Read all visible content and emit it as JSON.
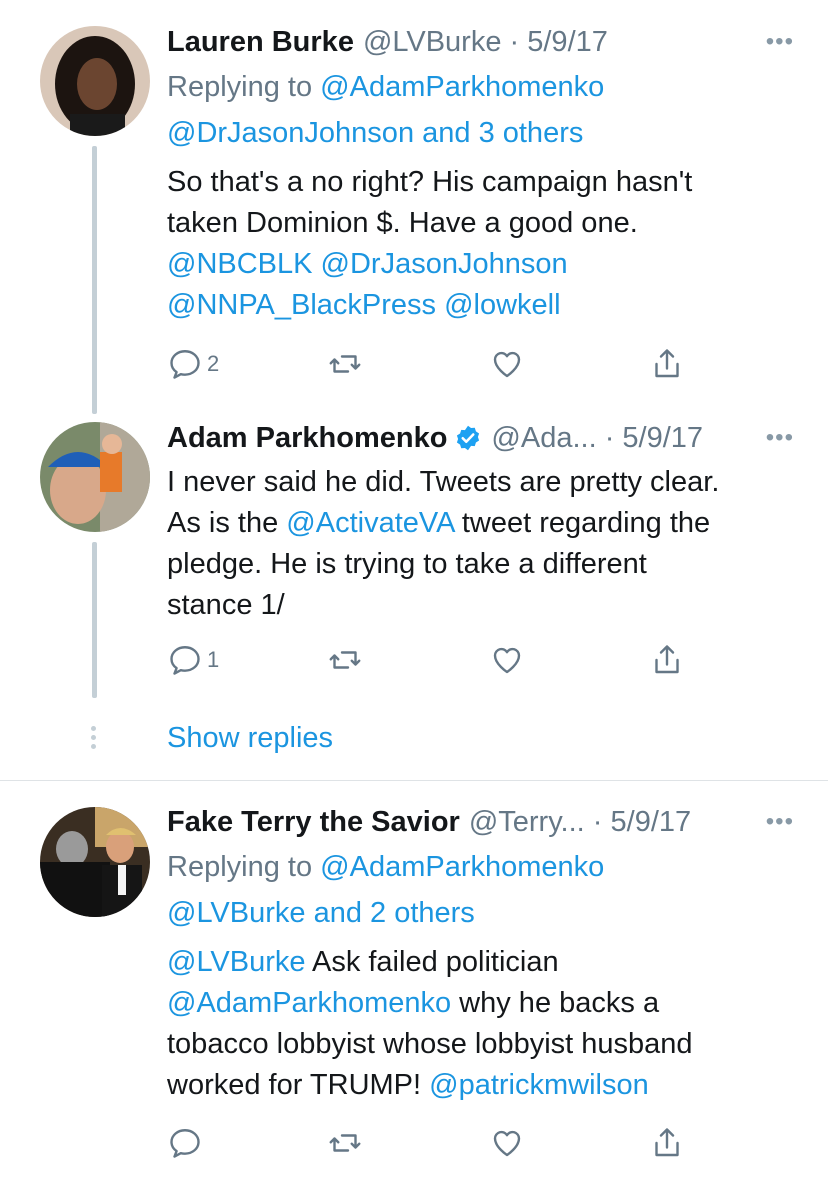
{
  "tweets": [
    {
      "name": "Lauren Burke",
      "handle": "@LVBurke",
      "date": "5/9/17",
      "verified": false,
      "replying_prefix": "Replying to ",
      "replying_to_1": "@AdamParkhomenko",
      "replying_to_2": "@DrJasonJohnson and 3 others",
      "body_line1": "So that's a no right? His campaign hasn't",
      "body_line2": "taken Dominion $. Have a good one.",
      "body_line3": "@NBCBLK @DrJasonJohnson",
      "body_line4": "@NNPA_BlackPress @lowkell",
      "reply_count": "2",
      "retweet_count": "",
      "like_count": ""
    },
    {
      "name": "Adam Parkhomenko",
      "handle": "@Ada...",
      "date": "5/9/17",
      "verified": true,
      "body_line1": "I never said he did. Tweets are pretty clear.",
      "body_line2_pre": "As is the ",
      "body_line2_link": "@ActivateVA",
      "body_line2_post": " tweet regarding the",
      "body_line3": "pledge. He is trying to take a different",
      "body_line4": "stance 1/",
      "reply_count": "1",
      "retweet_count": "",
      "like_count": ""
    },
    {
      "name": "Fake Terry the Savior",
      "handle": "@Terry...",
      "date": "5/9/17",
      "verified": false,
      "replying_prefix": "Replying to ",
      "replying_to_1": "@AdamParkhomenko",
      "replying_to_2": "@LVBurke and 2 others",
      "body_line1_link": "@LVBurke",
      "body_line1_post": " Ask failed politician",
      "body_line2_link": "@AdamParkhomenko",
      "body_line2_post": " why he backs a",
      "body_line3": "tobacco lobbyist whose lobbyist husband",
      "body_line4_pre": "worked for TRUMP! ",
      "body_line4_link": "@patrickmwilson",
      "reply_count": "",
      "retweet_count": "",
      "like_count": ""
    }
  ],
  "show_replies_label": "Show replies",
  "separator": " · ",
  "more_label": "•••",
  "icons": {
    "reply": "reply-icon",
    "retweet": "retweet-icon",
    "like": "like-icon",
    "share": "share-icon",
    "verified": "verified-badge-icon",
    "more": "more-options-icon"
  },
  "colors": {
    "link": "#1b95e0",
    "secondary_text": "#657786",
    "primary_text": "#14171a",
    "thread_line": "#c4cfd6",
    "verified": "#1da1f2"
  }
}
